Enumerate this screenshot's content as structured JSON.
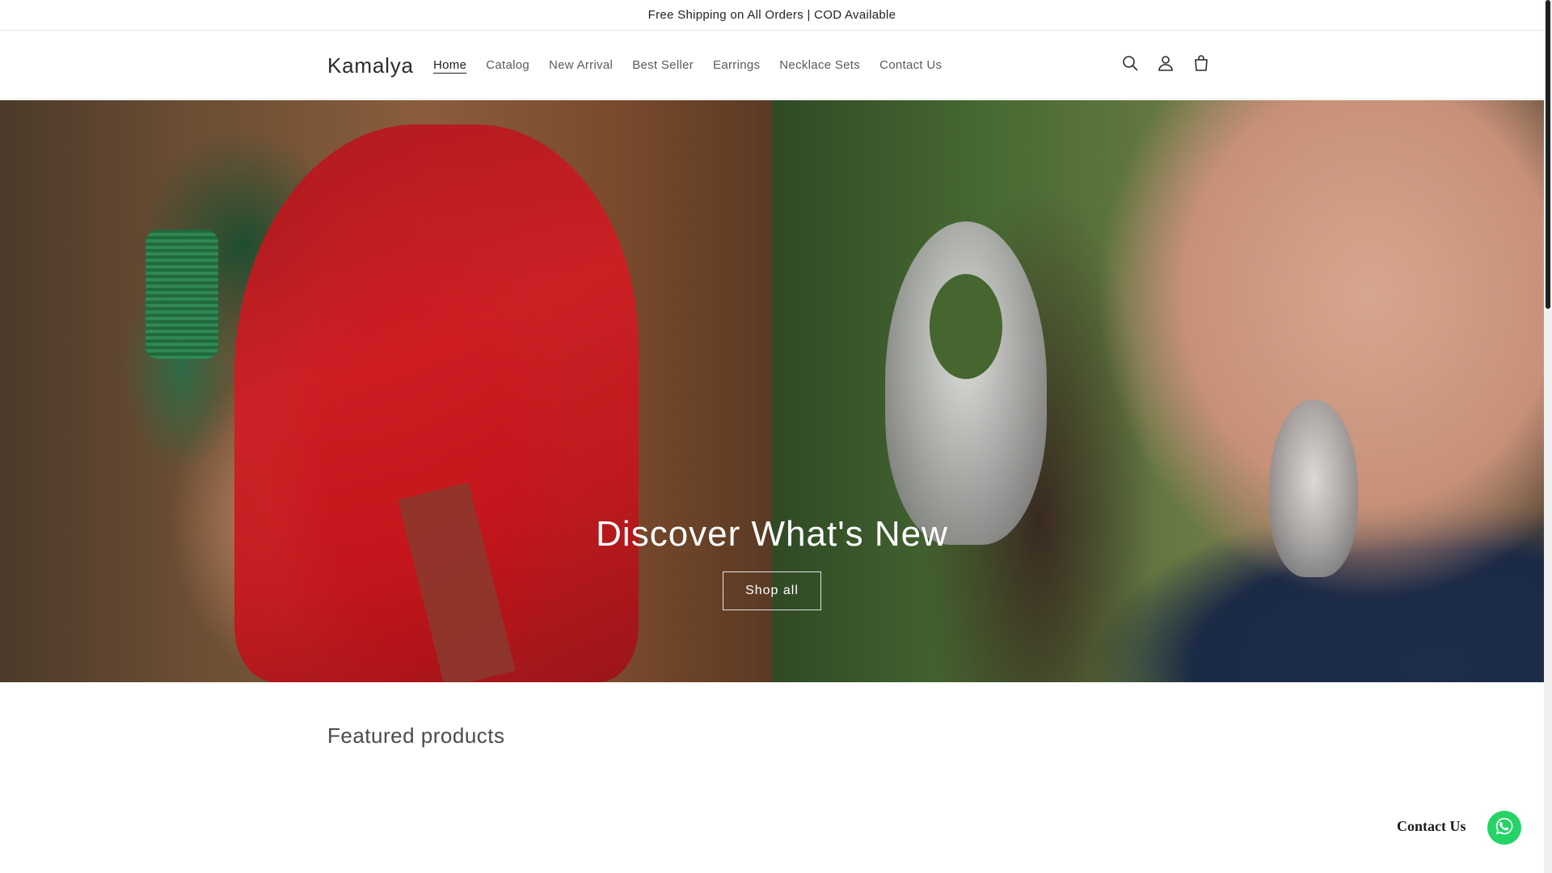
{
  "announcement": {
    "text": "Free Shipping on All Orders | COD Available"
  },
  "header": {
    "logo": "Kamalya",
    "nav": [
      {
        "label": "Home",
        "active": true
      },
      {
        "label": "Catalog",
        "active": false
      },
      {
        "label": "New Arrival",
        "active": false
      },
      {
        "label": "Best Seller",
        "active": false
      },
      {
        "label": "Earrings",
        "active": false
      },
      {
        "label": "Necklace Sets",
        "active": false
      },
      {
        "label": "Contact Us",
        "active": false
      }
    ],
    "icons": [
      "search-icon",
      "account-icon",
      "cart-icon"
    ]
  },
  "hero": {
    "title": "Discover What's New",
    "button_label": "Shop all",
    "images": [
      "woman-in-red-saree-with-green-bangles",
      "woman-wearing-silver-jhumka-earrings"
    ]
  },
  "featured": {
    "title": "Featured products"
  },
  "whatsapp": {
    "label": "Contact Us",
    "icon": "whatsapp-icon",
    "color": "#25d366"
  }
}
